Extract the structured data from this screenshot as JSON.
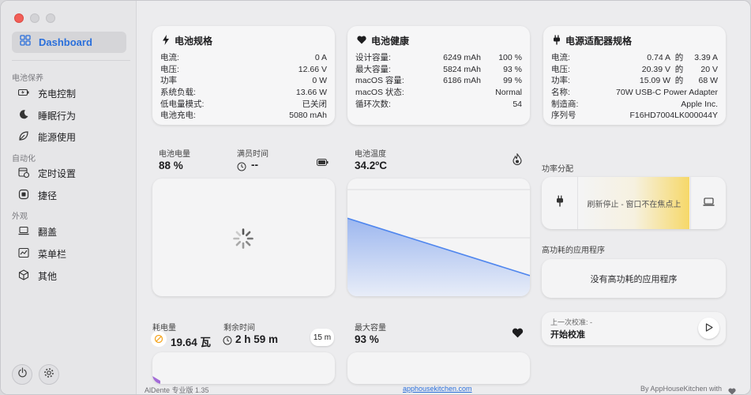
{
  "sidebar": {
    "active": "Dashboard",
    "sections": {
      "care": "电池保养",
      "automation": "自动化",
      "appearance": "外观"
    },
    "items": {
      "charge_control": "充电控制",
      "sleep": "睡眠行为",
      "energy": "能源使用",
      "schedule": "定时设置",
      "shortcuts": "捷径",
      "lid": "翻盖",
      "menubar": "菜单栏",
      "other": "其他"
    }
  },
  "battery_spec": {
    "title": "电池规格",
    "rows": [
      {
        "label": "电流:",
        "value": "0 A"
      },
      {
        "label": "电压:",
        "value": "12.66 V"
      },
      {
        "label": "功率",
        "value": "0 W"
      },
      {
        "label": "系统负载:",
        "value": "13.66 W"
      },
      {
        "label": "低电量模式:",
        "value": "已关闭"
      },
      {
        "label": "电池充电:",
        "value": "5080 mAh"
      }
    ]
  },
  "battery_health": {
    "title": "电池健康",
    "rows": [
      {
        "label": "设计容量:",
        "value": "6249 mAh",
        "value2": "100 %"
      },
      {
        "label": "最大容量:",
        "value": "5824 mAh",
        "value2": "93 %"
      },
      {
        "label": "macOS 容量:",
        "value": "6186 mAh",
        "value2": "99 %"
      },
      {
        "label": "macOS 状态:",
        "value": "",
        "value2": "Normal"
      },
      {
        "label": "循环次数:",
        "value": "",
        "value2": "54"
      }
    ]
  },
  "adapter_spec": {
    "title": "电源适配器规格",
    "rows": [
      {
        "label": "电流:",
        "value": "0.74 A",
        "mid": "的",
        "value2": "3.39 A"
      },
      {
        "label": "电压:",
        "value": "20.39 V",
        "mid": "的",
        "value2": "20 V"
      },
      {
        "label": "功率:",
        "value": "15.09 W",
        "mid": "的",
        "value2": "68 W"
      },
      {
        "label": "名称:",
        "value": "70W USB-C Power Adapter",
        "mid": "",
        "value2": ""
      },
      {
        "label": "制造商:",
        "value": "Apple Inc.",
        "mid": "",
        "value2": ""
      },
      {
        "label": "序列号",
        "value": "F16HD7004LK000044Y",
        "mid": "",
        "value2": ""
      }
    ]
  },
  "battery_level": {
    "label": "电池电量",
    "value": "88 %"
  },
  "full_time": {
    "label": "满员时间",
    "value": "--"
  },
  "battery_temp": {
    "label": "电池温度",
    "value": "34.2ºC"
  },
  "power_dist": {
    "label": "功率分配",
    "message": "刷新停止 - 窗口不在焦点上"
  },
  "high_power_apps": {
    "label": "高功耗的应用程序",
    "message": "没有高功耗的应用程序"
  },
  "calibration": {
    "last": "上一次校准: -",
    "start": "开始校准"
  },
  "consumption": {
    "label": "耗电量",
    "value": "19.64 瓦"
  },
  "remaining": {
    "label": "剩余时间",
    "value": "2 h 59 m"
  },
  "interval": {
    "value": "15 m"
  },
  "max_capacity": {
    "label": "最大容量",
    "value": "93 %"
  },
  "footer": {
    "version": "AlDente 专业版 1.35",
    "link": "apphousekitchen.com",
    "by": "By AppHouseKitchen with"
  },
  "chart_data": {
    "type": "area",
    "x": [
      0,
      1
    ],
    "values": [
      34.2,
      33.6
    ],
    "ylim": [
      33.5,
      34.5
    ]
  },
  "colors": {
    "accent": "#2a6fdb",
    "warning": "#f5a623"
  }
}
